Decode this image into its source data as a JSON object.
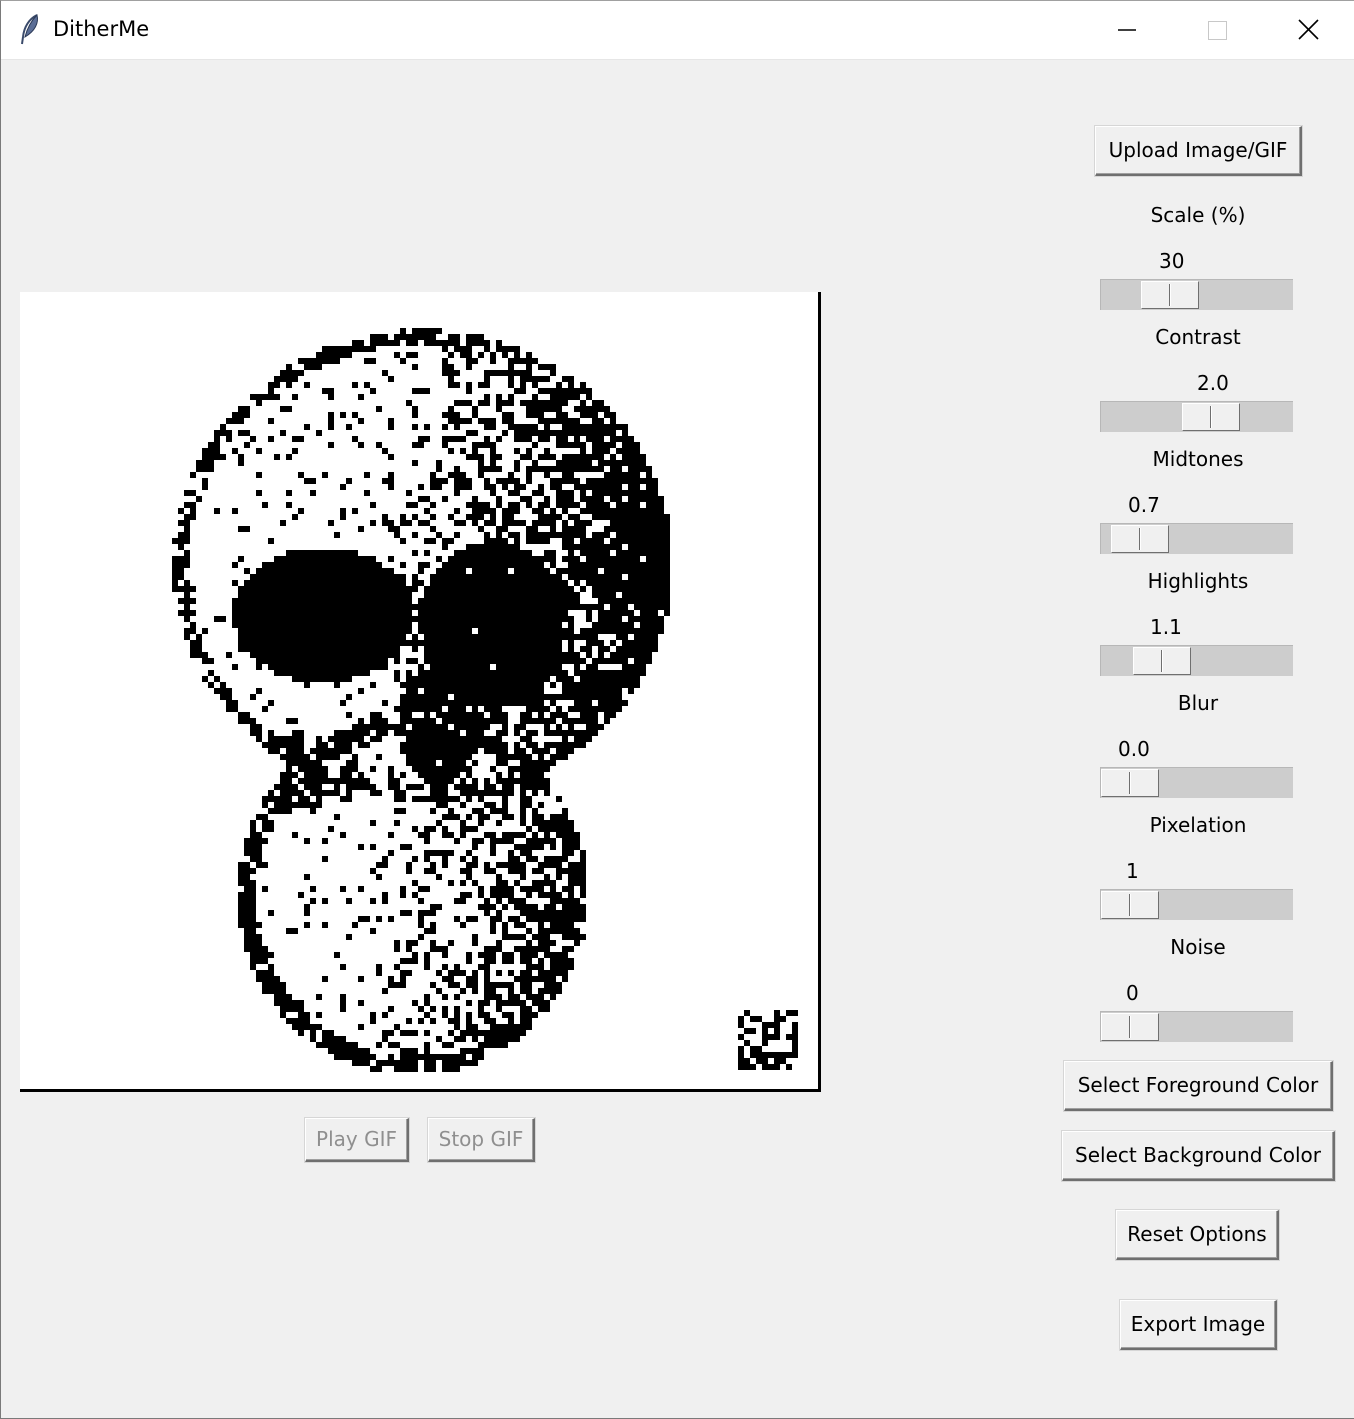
{
  "window": {
    "title": "DitherMe"
  },
  "controls": {
    "upload": "Upload Image/GIF",
    "sliders": [
      {
        "label": "Scale (%)",
        "value": "30"
      },
      {
        "label": "Contrast",
        "value": "2.0"
      },
      {
        "label": "Midtones",
        "value": "0.7"
      },
      {
        "label": "Highlights",
        "value": "1.1"
      },
      {
        "label": "Blur",
        "value": "0.0"
      },
      {
        "label": "Pixelation",
        "value": "1"
      },
      {
        "label": "Noise",
        "value": "0"
      }
    ],
    "foreground": "Select Foreground Color",
    "background": "Select Background Color",
    "reset": "Reset Options",
    "export": "Export Image"
  },
  "gif": {
    "play": "Play GIF",
    "stop": "Stop GIF"
  },
  "icons": {
    "app": "feather-icon",
    "minimize": "minimize-icon",
    "maximize": "maximize-icon",
    "close": "close-icon"
  }
}
